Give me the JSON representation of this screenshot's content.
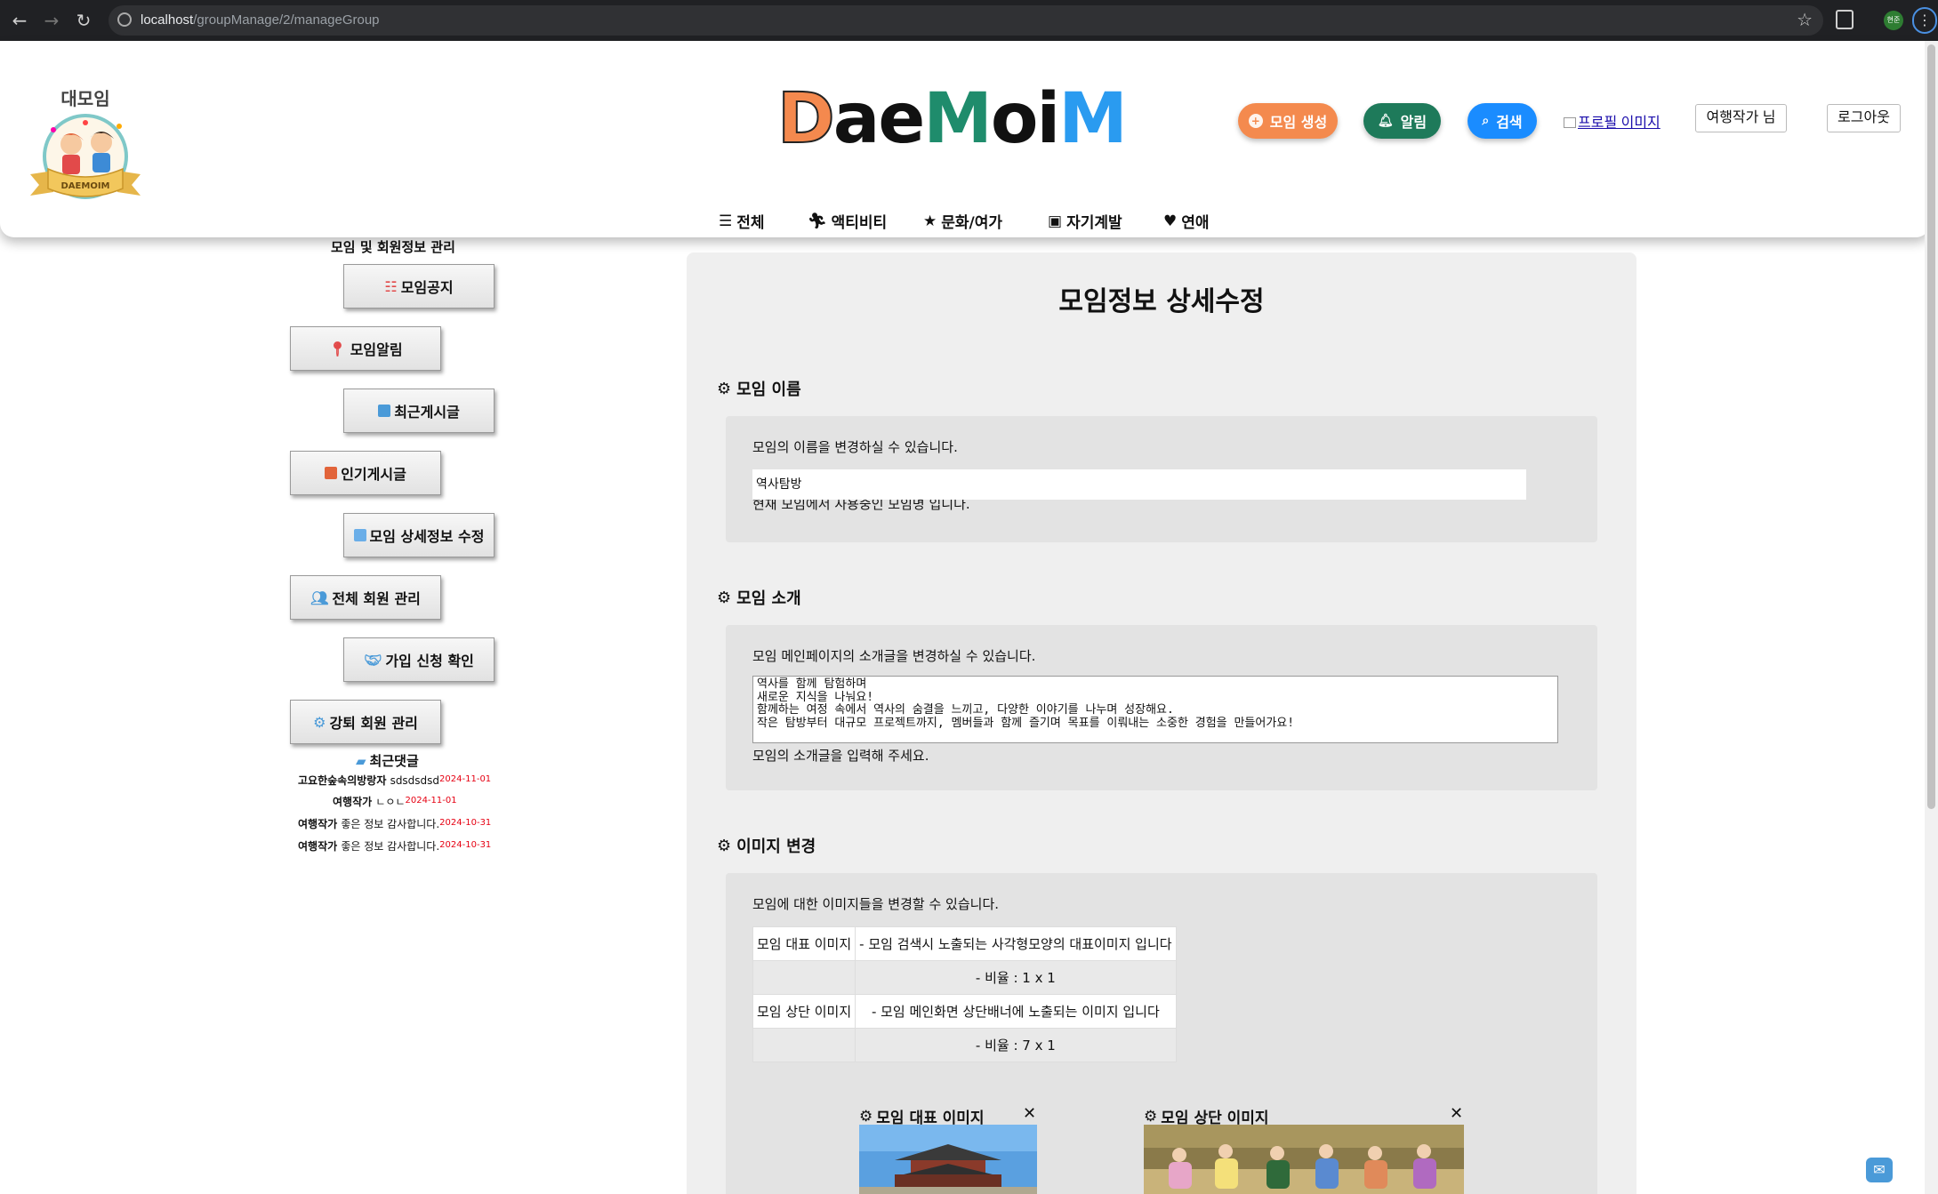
{
  "browser": {
    "url_host": "localhost",
    "url_path": "/groupManage/2/manageGroup",
    "profile_label": "현준"
  },
  "header": {
    "logo_text": "대모임",
    "logo_ribbon": "DAEMOIM",
    "brand": "DaeMoiM",
    "create_label": "모임 생성",
    "alarm_label": "알림",
    "search_label": "검색",
    "profile_alt": "프로필 이미지",
    "user_label": "여행작가 님",
    "logout_label": "로그아웃",
    "categories": [
      "전체",
      "액티비티",
      "문화/여가",
      "자기계발",
      "연애"
    ]
  },
  "sidebar": {
    "title": "모임 및 회원정보 관리",
    "items": [
      {
        "label": "모임공지",
        "icon": "list-icon"
      },
      {
        "label": "모임알림",
        "icon": "pin-icon"
      },
      {
        "label": "최근게시글",
        "icon": "post-icon"
      },
      {
        "label": "인기게시글",
        "icon": "hot-post-icon"
      },
      {
        "label": "모임 상세정보 수정",
        "icon": "clipboard-icon"
      },
      {
        "label": "전체 회원 관리",
        "icon": "users-icon"
      },
      {
        "label": "가입 신청 확인",
        "icon": "handshake-icon"
      },
      {
        "label": "강퇴 회원 관리",
        "icon": "gears-icon"
      }
    ],
    "recent_comments_title": "최근댓글",
    "recent_comments": [
      {
        "author": "고요한숲속의방랑자",
        "text": "sdsdsdsd",
        "date": "2024-11-01"
      },
      {
        "author": "여행작가",
        "text": "ㄴㅇㄴ",
        "date": "2024-11-01"
      },
      {
        "author": "여행작가",
        "text": "좋은 정보 감사합니다.",
        "date": "2024-10-31"
      },
      {
        "author": "여행작가",
        "text": "좋은 정보 감사합니다.",
        "date": "2024-10-31"
      }
    ]
  },
  "main": {
    "title": "모임정보 상세수정",
    "name_section": {
      "heading": "모임 이름",
      "desc": "모임의 이름을 변경하실 수 있습니다.",
      "value": "역사탐방",
      "note": "현재 모임에서 사용중인 모임명 입니다."
    },
    "intro_section": {
      "heading": "모임 소개",
      "desc": "모임 메인페이지의 소개글을 변경하실 수 있습니다.",
      "value": "역사를 함께 탐험하며\n새로운 지식을 나눠요!\n함께하는 여정 속에서 역사의 숨결을 느끼고, 다양한 이야기를 나누며 성장해요.\n작은 탐방부터 대규모 프로젝트까지, 멤버들과 함께 즐기며 목표를 이뤄내는 소중한 경험을 만들어가요!",
      "note": "모임의 소개글을 입력해 주세요."
    },
    "image_section": {
      "heading": "이미지 변경",
      "desc": "모임에 대한 이미지들을 변경할 수 있습니다.",
      "rows": [
        {
          "label": "모임 대표 이미지",
          "value": "- 모임 검색시 노출되는 사각형모양의 대표이미지 입니다"
        },
        {
          "label": "",
          "value": "- 비율 : 1 x 1"
        },
        {
          "label": "모임 상단 이미지",
          "value": "- 모임 메인화면 상단배너에 노출되는 이미지 입니다"
        },
        {
          "label": "",
          "value": "- 비율 : 7 x 1"
        }
      ],
      "card_main": "모임 대표 이미지",
      "card_top": "모임 상단 이미지",
      "close_symbol": "✕"
    }
  }
}
